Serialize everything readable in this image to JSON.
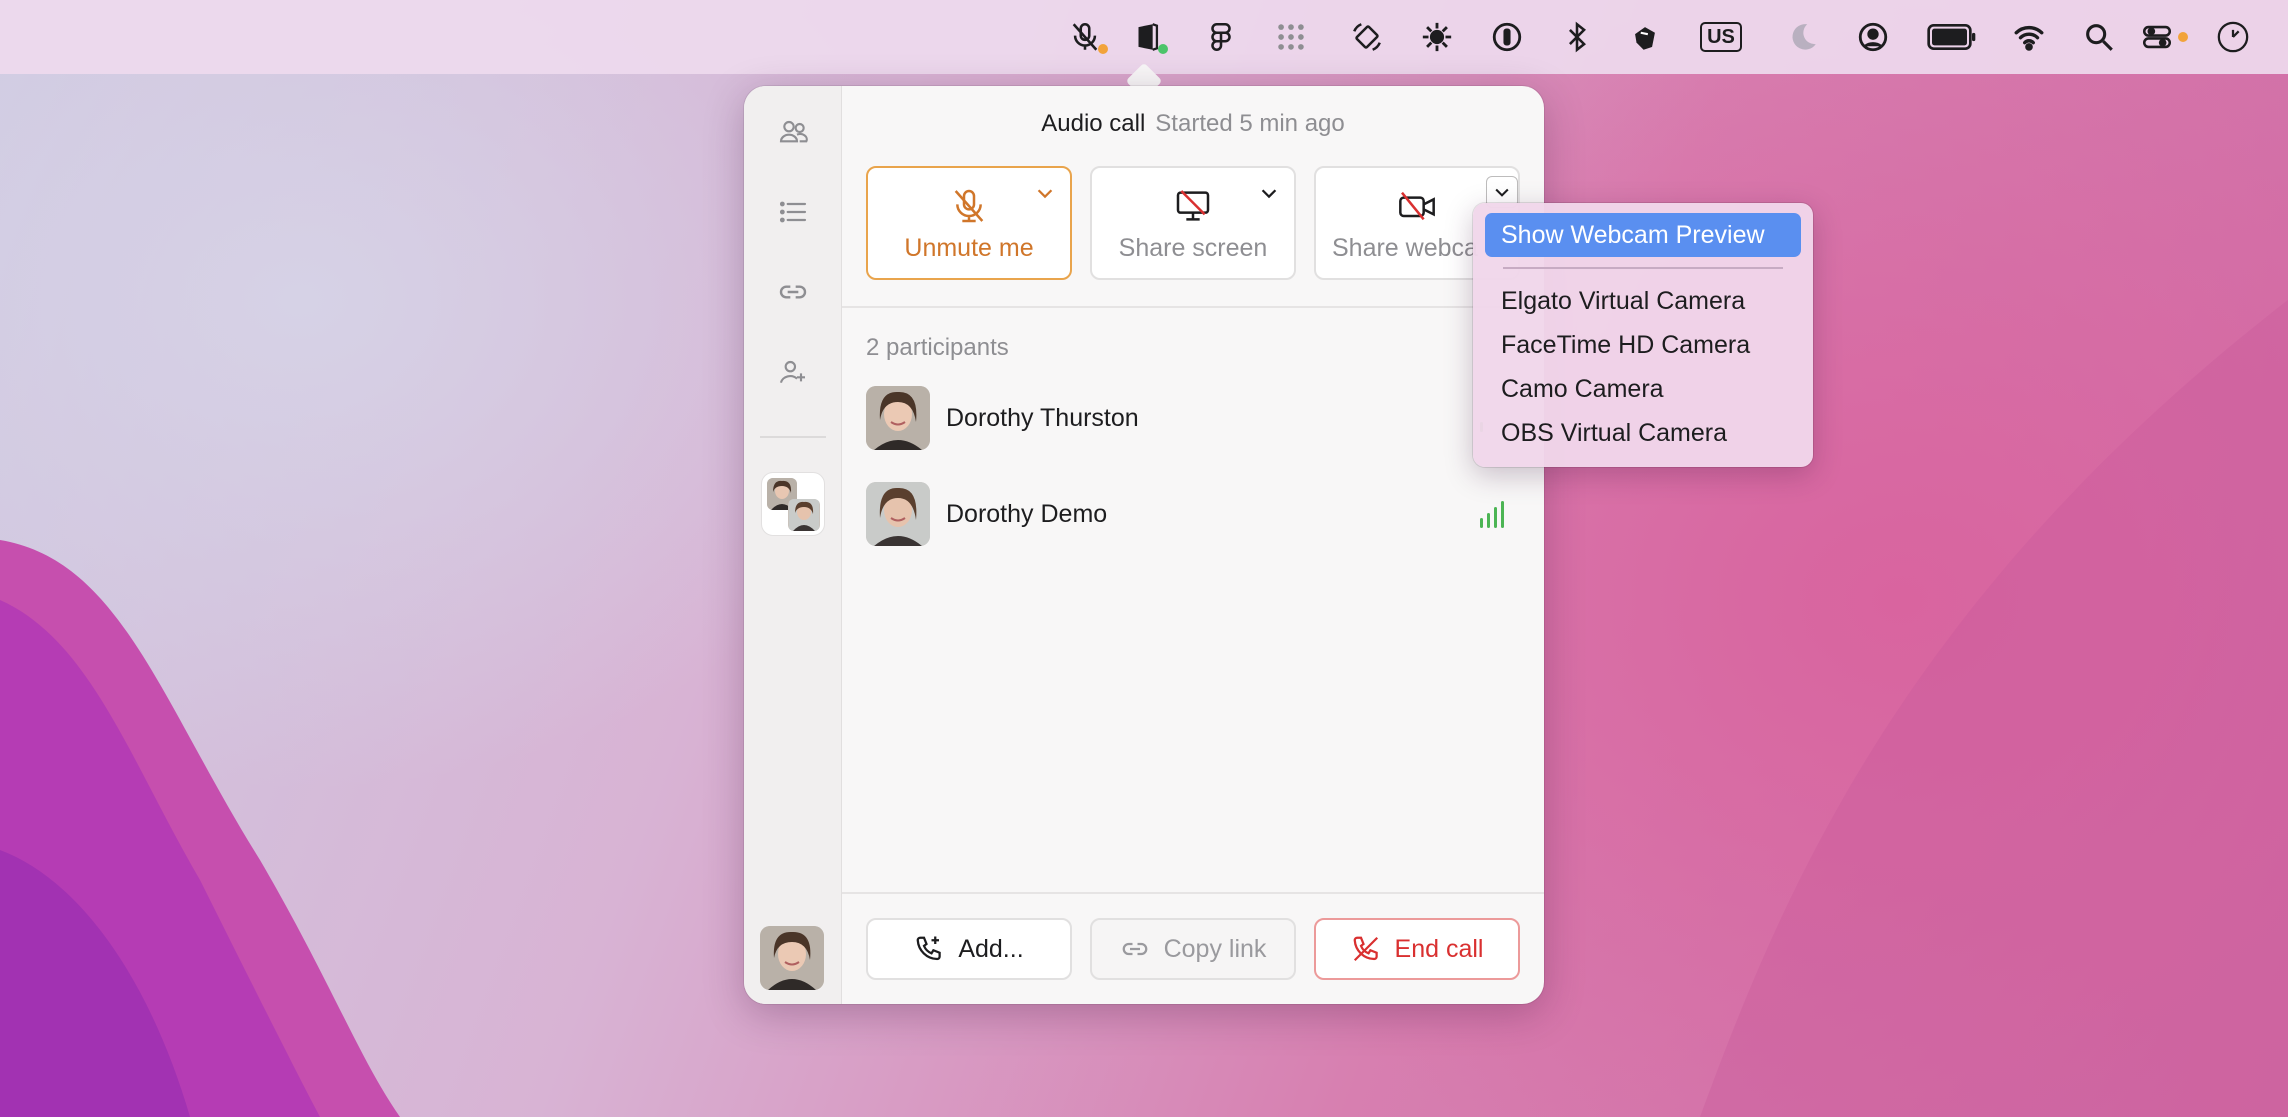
{
  "menubar": {
    "icons": [
      "mic-muted-icon",
      "app-status-icon",
      "figma-icon",
      "grid-dots-icon",
      "rotate-icon",
      "sun-icon",
      "password-icon",
      "bluetooth-icon",
      "hand-icon",
      "keyboard-layout-icon",
      "moon-icon",
      "user-icon",
      "battery-icon",
      "wifi-icon",
      "search-icon",
      "control-center-icon",
      "clock-icon"
    ],
    "keyboard_layout": "US",
    "accent_orange": "#f2a33a",
    "accent_green": "#4cc46a"
  },
  "call": {
    "title": "Audio call",
    "subtitle": "Started 5 min ago",
    "controls": {
      "unmute_label": "Unmute me",
      "share_screen_label": "Share screen",
      "share_webcam_label": "Share webca"
    },
    "participants_label": "2 participants",
    "participants": [
      {
        "name": "Dorothy Thurston"
      },
      {
        "name": "Dorothy Demo"
      }
    ],
    "footer": {
      "add_label": "Add...",
      "copy_label": "Copy link",
      "end_label": "End call"
    }
  },
  "sidebar": {
    "items": [
      "people-icon",
      "list-icon",
      "link-icon",
      "add-person-icon"
    ]
  },
  "webcam_menu": {
    "highlighted": "Show Webcam Preview",
    "cameras": [
      "Elgato Virtual Camera",
      "FaceTime HD Camera",
      "Camo Camera",
      "OBS Virtual Camera"
    ]
  }
}
